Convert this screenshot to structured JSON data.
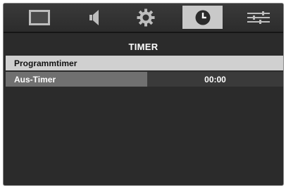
{
  "tabs": [
    {
      "icon": "picture-icon",
      "active": false
    },
    {
      "icon": "speaker-icon",
      "active": false
    },
    {
      "icon": "gear-icon",
      "active": false
    },
    {
      "icon": "clock-icon",
      "active": true
    },
    {
      "icon": "sliders-icon",
      "active": false
    }
  ],
  "menu": {
    "title": "TIMER",
    "items": [
      {
        "label": "Programmtimer",
        "value": ""
      },
      {
        "label": "Aus-Timer",
        "value": "00:00"
      }
    ]
  },
  "colors": {
    "background": "#2b2b2b",
    "active_tab": "#c9c9c9",
    "selected_row": "#d0d0d0",
    "label_cell": "#707070"
  }
}
